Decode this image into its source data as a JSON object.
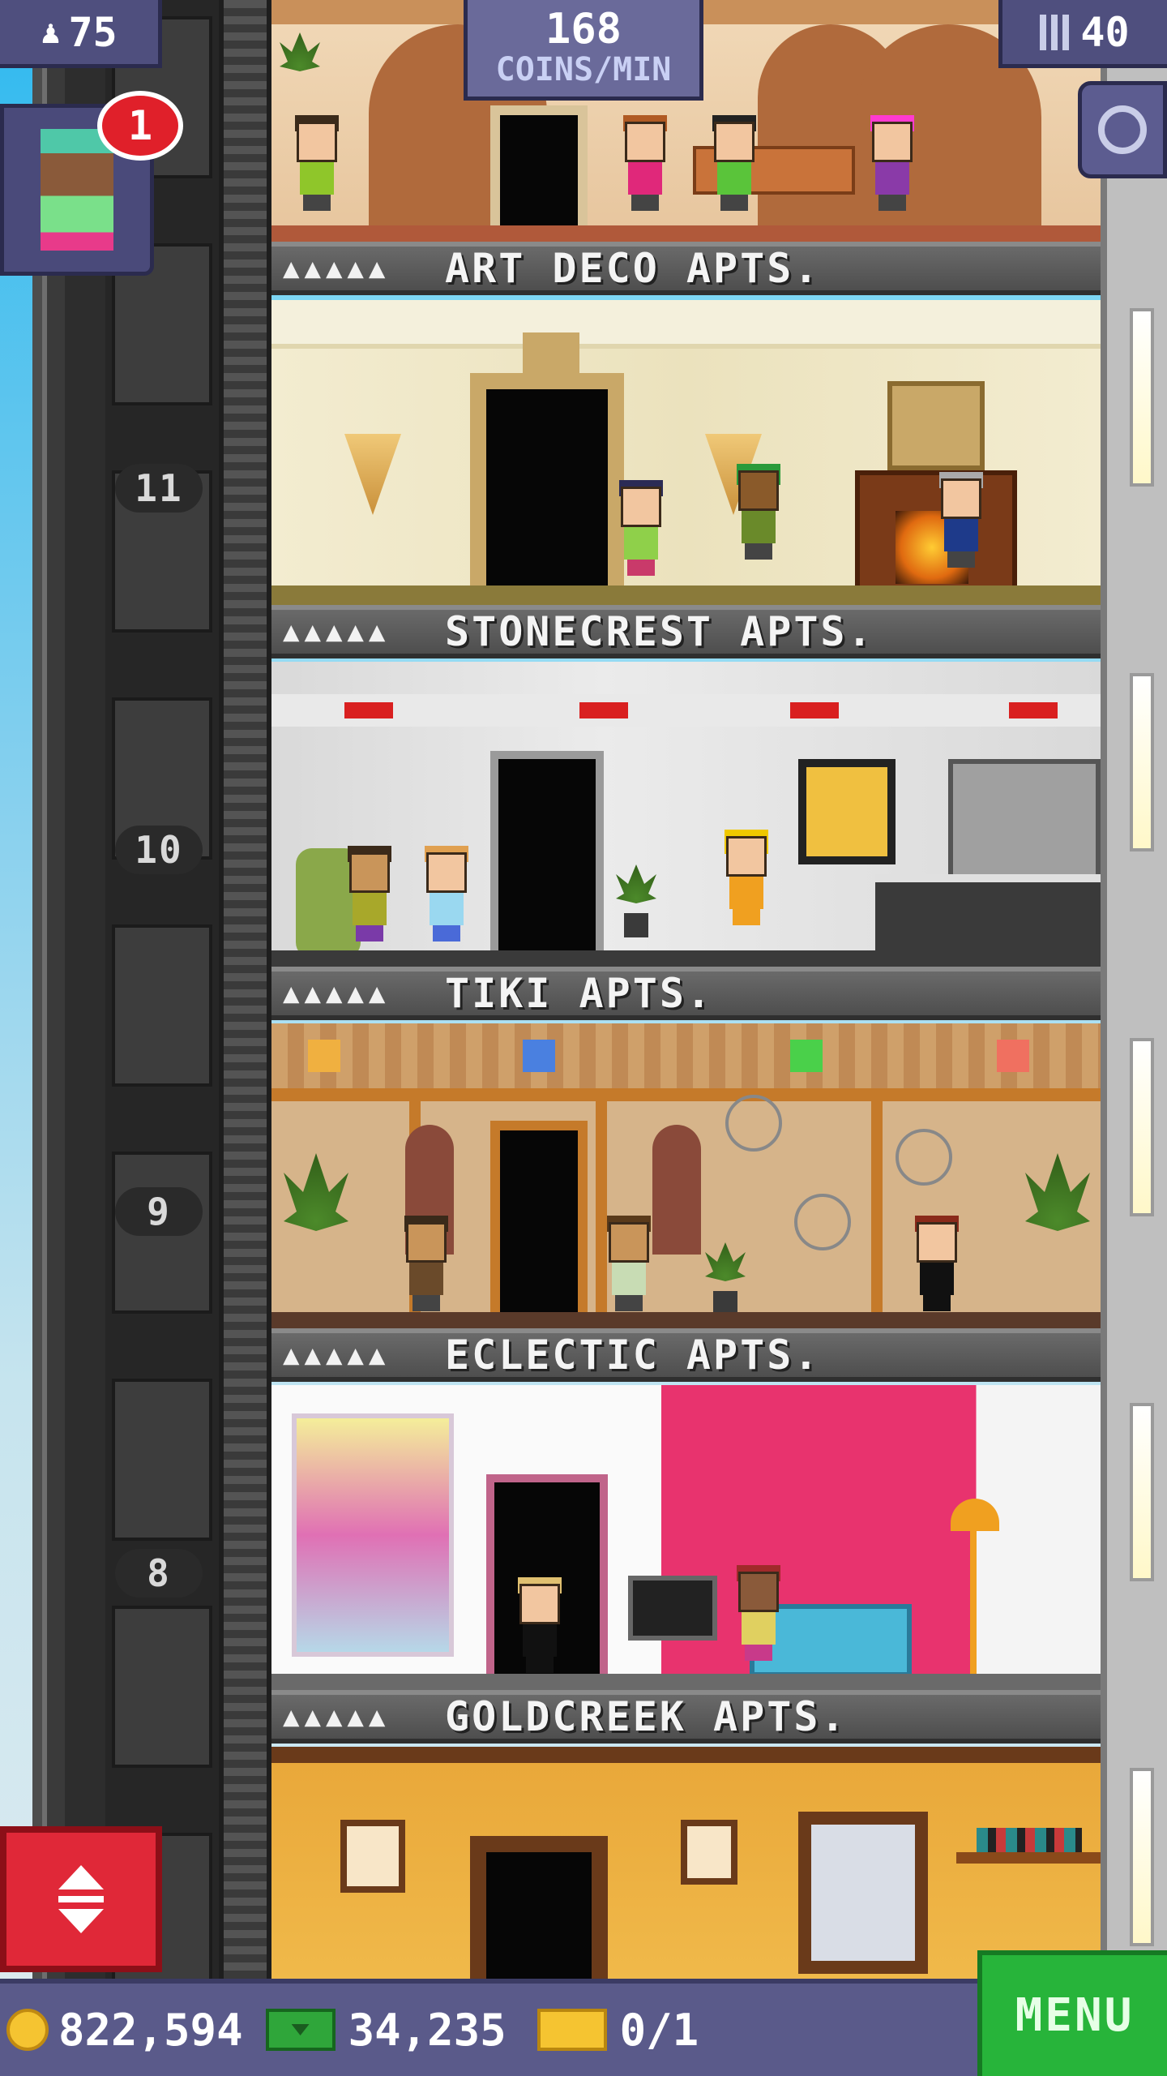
{
  "hud": {
    "population": "75",
    "coins_per_min_value": "168",
    "coins_per_min_label": "COINS/MIN",
    "floor_count": "40",
    "notification_count": "1"
  },
  "floor_numbers": [
    "11",
    "10",
    "9",
    "8"
  ],
  "floors": [
    {
      "name": "ART DECO APTS.",
      "stars": "▲▲▲▲▲"
    },
    {
      "name": "STONECREST APTS.",
      "stars": "▲▲▲▲▲"
    },
    {
      "name": "TIKI APTS.",
      "stars": "▲▲▲▲▲"
    },
    {
      "name": "ECLECTIC APTS.",
      "stars": "▲▲▲▲▲"
    },
    {
      "name": "GOLDCREEK APTS.",
      "stars": "▲▲▲▲▲"
    }
  ],
  "bottom_bar": {
    "coins": "822,594",
    "bux": "34,235",
    "tickets": "0/1",
    "menu_label": "MENU"
  },
  "colors": {
    "hud_bg": "#4f4f7e",
    "menu_green": "#27b43a",
    "elevator_red": "#e02838",
    "coin_gold": "#f5c431"
  }
}
